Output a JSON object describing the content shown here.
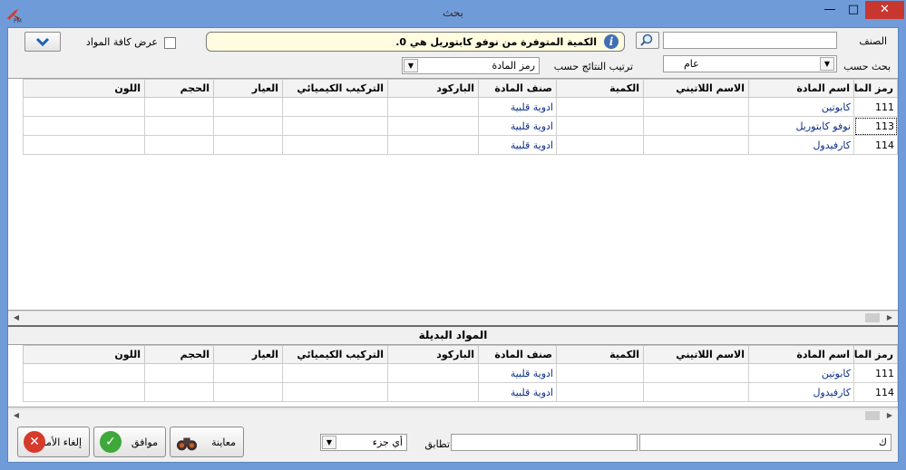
{
  "window": {
    "title": "بحث"
  },
  "filters": {
    "category_label": "الصنف",
    "category_value": "",
    "search_by_label": "بحث حسب",
    "search_by_value": "عام",
    "sort_label": "ترتيب النتائج حسب",
    "sort_value": "رمز المادة",
    "show_all_label": "عرض كافة المواد",
    "info_message": "الكمية المتوفرة من  نوفو كابتوريل هي 0."
  },
  "columns": [
    "رمز المادة",
    "اسم المادة",
    "الاسم اللاتيني",
    "الكمية",
    "صنف المادة",
    "الباركود",
    "التركيب الكيميائي",
    "العيار",
    "الحجم",
    "اللون"
  ],
  "main_rows": [
    [
      "111",
      "كابوتين",
      "",
      "",
      "ادوية قلبية",
      "",
      "",
      "",
      "",
      ""
    ],
    [
      "113",
      "نوفو كابتوريل",
      "",
      "",
      "ادوية قلبية",
      "",
      "",
      "",
      "",
      ""
    ],
    [
      "114",
      "كارفيدول",
      "",
      "",
      "ادوية قلبية",
      "",
      "",
      "",
      "",
      ""
    ]
  ],
  "alternatives": {
    "title": "المواد البديلة",
    "rows": [
      [
        "111",
        "كابوتين",
        "",
        "",
        "ادوية قلبية",
        "",
        "",
        "",
        "",
        ""
      ],
      [
        "114",
        "كارفيدول",
        "",
        "",
        "ادوية قلبية",
        "",
        "",
        "",
        "",
        ""
      ]
    ]
  },
  "footer": {
    "filter_value_1": "ك",
    "filter_value_2": "",
    "match_label": "تطابق",
    "match_value": "أي جزء",
    "preview_label": "معاينة",
    "ok_label": "موافق",
    "cancel_label": "إلغاء الأمر"
  },
  "colors": {
    "title_bar": "#6f9bd9",
    "close": "#c7372f",
    "info_bg": "#fffce0",
    "value_text": "#0d2f85"
  }
}
